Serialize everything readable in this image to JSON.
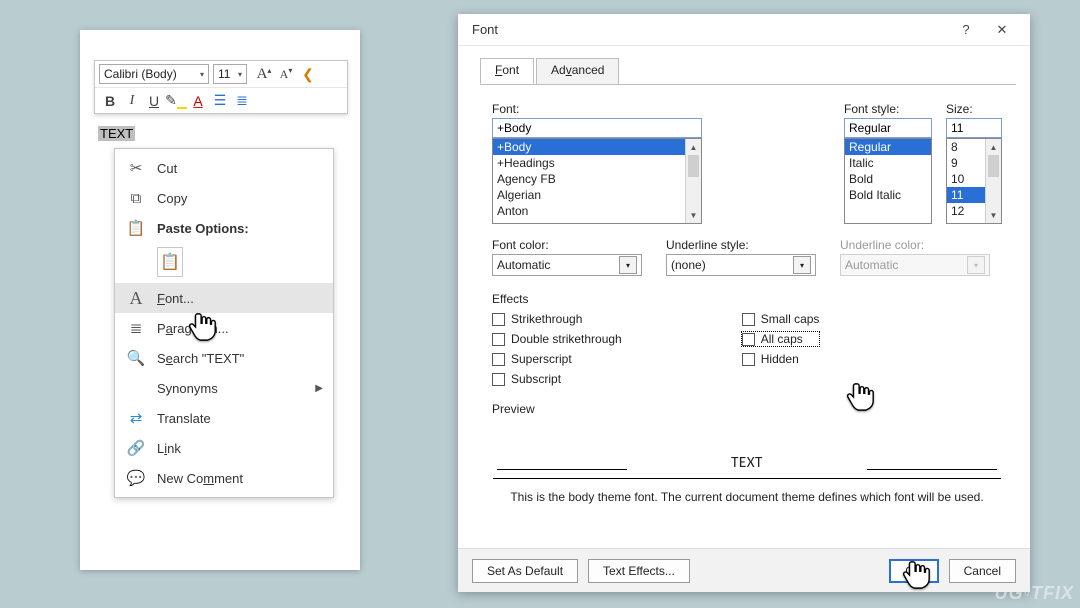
{
  "toolbar": {
    "font_name": "Calibri (Body)",
    "font_size": "11"
  },
  "selected_text": "TEXT",
  "context_menu": {
    "cut": "Cut",
    "copy": "Copy",
    "paste_header": "Paste Options:",
    "font": "Font...",
    "paragraph": "Paragraph...",
    "search": "Search \"TEXT\"",
    "synonyms": "Synonyms",
    "translate": "Translate",
    "link": "Link",
    "new_comment": "New Comment"
  },
  "dialog": {
    "title": "Font",
    "tabs": {
      "font": "Font",
      "advanced": "Advanced"
    },
    "labels": {
      "font": "Font:",
      "style": "Font style:",
      "size": "Size:",
      "font_color": "Font color:",
      "underline_style": "Underline style:",
      "underline_color": "Underline color:",
      "effects": "Effects",
      "preview": "Preview"
    },
    "font_input": "+Body",
    "font_list": [
      "+Body",
      "+Headings",
      "Agency FB",
      "Algerian",
      "Anton"
    ],
    "style_input": "Regular",
    "style_list": [
      "Regular",
      "Italic",
      "Bold",
      "Bold Italic"
    ],
    "size_input": "11",
    "size_list": [
      "8",
      "9",
      "10",
      "11",
      "12"
    ],
    "font_color_value": "Automatic",
    "underline_style_value": "(none)",
    "underline_color_value": "Automatic",
    "effects_left": {
      "strikethrough": "Strikethrough",
      "double_strike": "Double strikethrough",
      "superscript": "Superscript",
      "subscript": "Subscript"
    },
    "effects_right": {
      "small_caps": "Small caps",
      "all_caps": "All caps",
      "hidden": "Hidden"
    },
    "preview_text": "TEXT",
    "hint": "This is the body theme font. The current document theme defines which font will be used.",
    "buttons": {
      "set_default": "Set As Default",
      "text_effects": "Text Effects...",
      "ok": "OK",
      "cancel": "Cancel"
    }
  },
  "watermark": "UG◦TFIX"
}
